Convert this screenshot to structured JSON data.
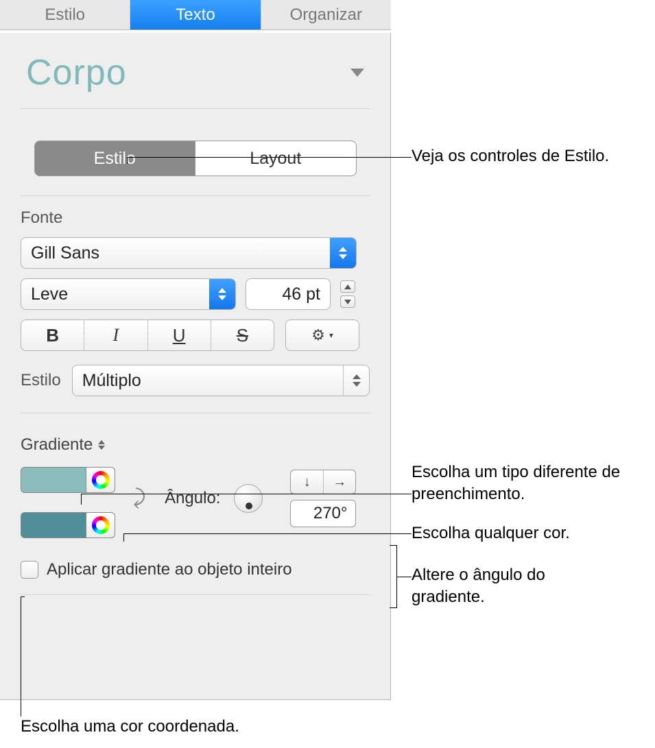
{
  "tabs": {
    "style": "Estilo",
    "text": "Texto",
    "arrange": "Organizar"
  },
  "styleTitle": "Corpo",
  "seg": {
    "style": "Estilo",
    "layout": "Layout"
  },
  "fontSection": {
    "label": "Fonte",
    "family": "Gill Sans",
    "weight": "Leve",
    "size": "46 pt"
  },
  "biu": {
    "bold": "B",
    "italic": "I",
    "underline": "U",
    "strike": "S"
  },
  "charStyle": {
    "label": "Estilo",
    "value": "Múltiplo"
  },
  "fill": {
    "label": "Gradiente",
    "angleLabel": "Ângulo:",
    "angleValue": "270°",
    "color1": "#8cbdbd",
    "color2": "#508f97",
    "applyLabel": "Aplicar gradiente ao objeto inteiro"
  },
  "callouts": {
    "styleControls": "Veja os controles de Estilo.",
    "fillType": "Escolha um tipo diferente de preenchimento.",
    "anyColor": "Escolha qualquer cor.",
    "changeAngle": "Altere o ângulo do gradiente.",
    "matchColor": "Escolha uma cor coordenada."
  }
}
